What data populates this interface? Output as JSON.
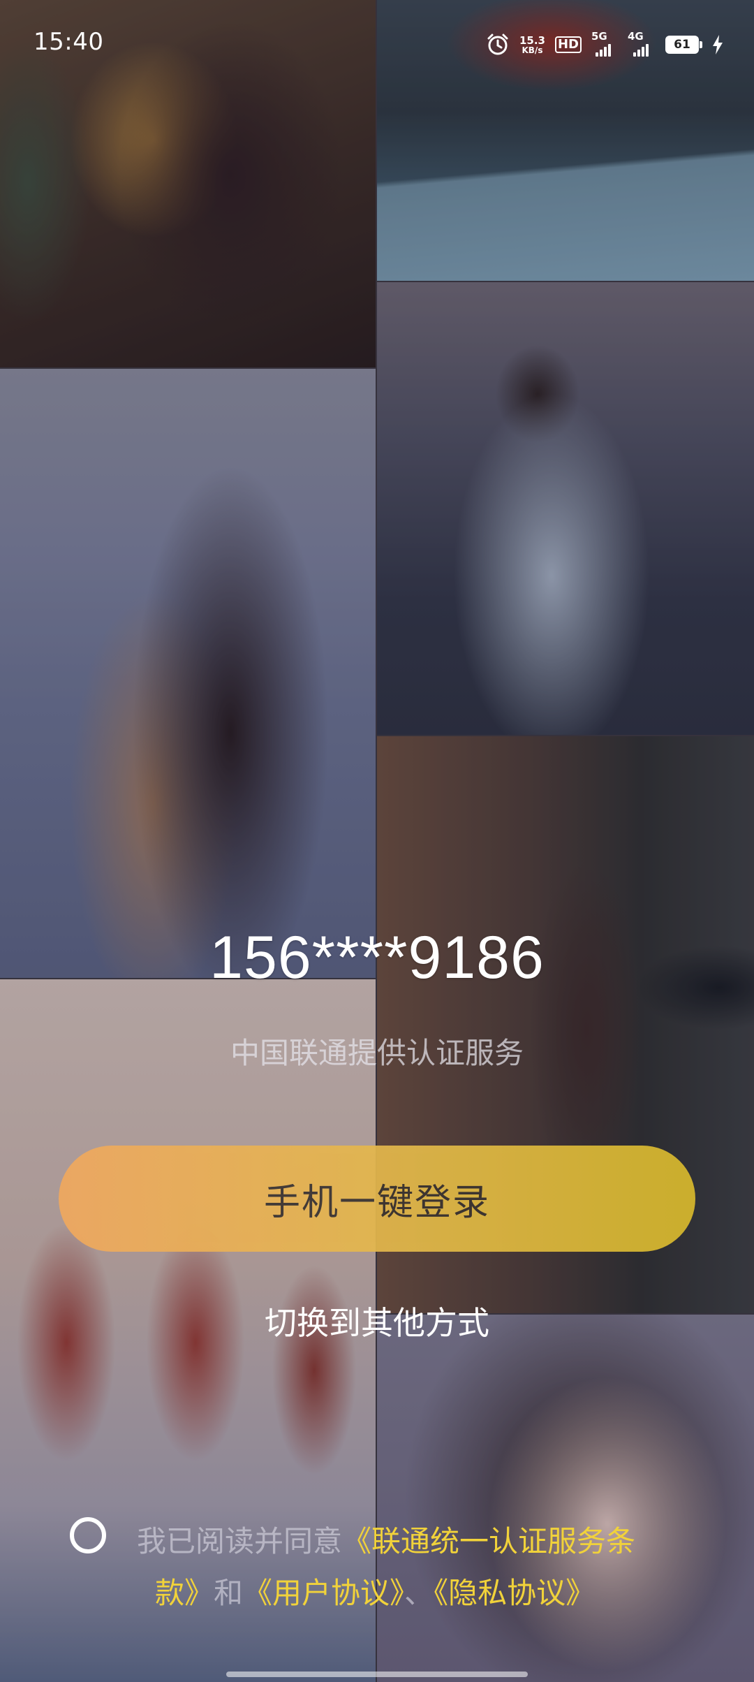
{
  "status_bar": {
    "time": "15:40",
    "net_speed_value": "15.3",
    "net_speed_unit": "KB/s",
    "hd_label": "HD",
    "signal1_label": "5G",
    "signal2_label": "4G",
    "battery_level": "61",
    "icons": [
      "alarm-icon",
      "hd-icon",
      "signal-5g-icon",
      "signal-4g-icon",
      "battery-icon",
      "charging-bolt-icon"
    ]
  },
  "login": {
    "phone_number": "156****9186",
    "auth_provider": "中国联通提供认证服务",
    "one_click_label": "手机一键登录",
    "switch_label": "切换到其他方式"
  },
  "agreement": {
    "prefix": "我已阅读并同意",
    "link_service_part1": "《联通统一认证服务条",
    "link_service_part2": "款》",
    "conj_and": "和",
    "link_user": "《用户协议》",
    "separator": "、",
    "link_privacy": "《隐私协议》"
  },
  "colors": {
    "button_gradient_start": "#f0a85e",
    "button_gradient_end": "#d8b92c",
    "link_color": "#f1d23a"
  }
}
